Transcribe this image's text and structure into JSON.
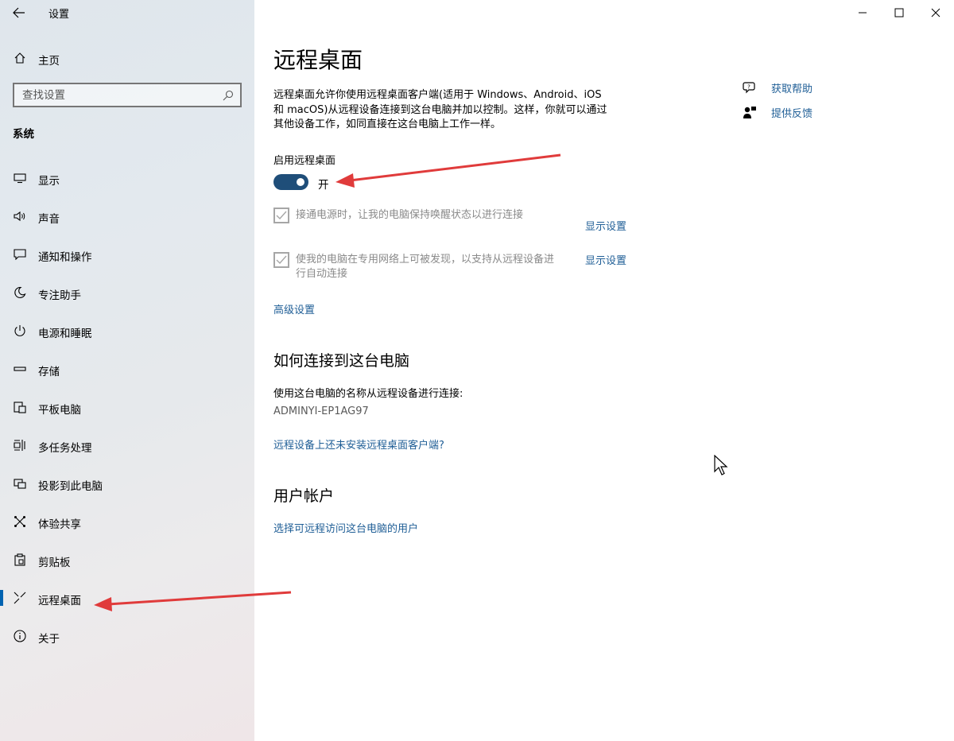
{
  "window": {
    "title": "设置",
    "controls": {
      "minimize": "—",
      "maximize": "☐",
      "close": "✕"
    }
  },
  "sidebar": {
    "home_label": "主页",
    "search_placeholder": "查找设置",
    "section_title": "系统",
    "items": [
      {
        "label": "显示",
        "icon": "monitor-icon"
      },
      {
        "label": "声音",
        "icon": "speaker-icon"
      },
      {
        "label": "通知和操作",
        "icon": "notification-icon"
      },
      {
        "label": "专注助手",
        "icon": "moon-icon"
      },
      {
        "label": "电源和睡眠",
        "icon": "power-icon"
      },
      {
        "label": "存储",
        "icon": "storage-icon"
      },
      {
        "label": "平板电脑",
        "icon": "tablet-icon"
      },
      {
        "label": "多任务处理",
        "icon": "multitask-icon"
      },
      {
        "label": "投影到此电脑",
        "icon": "project-icon"
      },
      {
        "label": "体验共享",
        "icon": "share-icon"
      },
      {
        "label": "剪贴板",
        "icon": "clipboard-icon"
      },
      {
        "label": "远程桌面",
        "icon": "remote-desktop-icon",
        "selected": true
      },
      {
        "label": "关于",
        "icon": "info-icon"
      }
    ]
  },
  "main": {
    "title": "远程桌面",
    "intro_line1": "远程桌面允许你使用远程桌面客户端(适用于 Windows、Android、iOS",
    "intro_line2": "和 macOS)从远程设备连接到这台电脑并加以控制。这样，你就可以通过",
    "intro_line3": "其他设备工作，如同直接在这台电脑上工作一样。",
    "enable_label": "启用远程桌面",
    "toggle_state": "开",
    "toggle_on": true,
    "option1_text": "接通电源时，让我的电脑保持唤醒状态以进行连接",
    "option1_link": "显示设置",
    "option2_line1": "使我的电脑在专用网络上可被发现，以支持从远程设备进",
    "option2_line2": "行自动连接",
    "option2_link": "显示设置",
    "advanced_link": "高级设置",
    "connect_heading": "如何连接到这台电脑",
    "connect_text": "使用这台电脑的名称从远程设备进行连接:",
    "pc_name": "ADMINYI-EP1AG97",
    "client_link": "远程设备上还未安装远程桌面客户端?",
    "accounts_heading": "用户帐户",
    "accounts_link": "选择可远程访问这台电脑的用户",
    "help_link": "获取帮助",
    "feedback_link": "提供反馈"
  },
  "colors": {
    "accent": "#1f4e79",
    "link": "#1f5e96",
    "annotation_arrow": "#e03b3b"
  }
}
